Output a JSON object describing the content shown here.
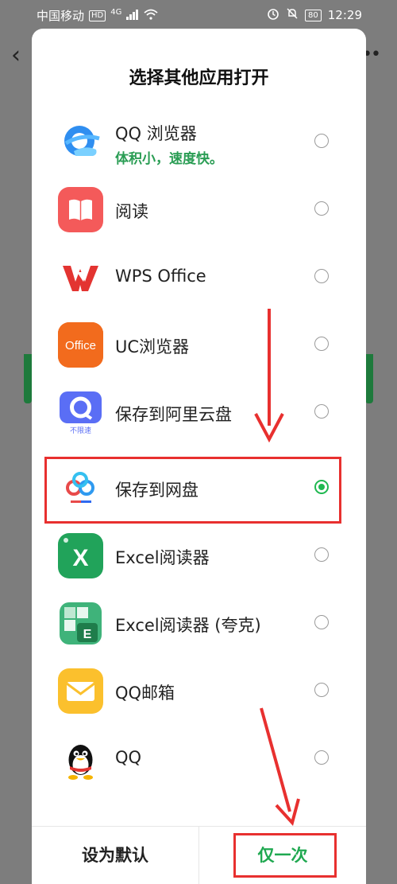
{
  "status_bar": {
    "carrier": "中国移动",
    "hd": "HD",
    "network": "4G",
    "battery": "80",
    "time": "12:29"
  },
  "sheet": {
    "title": "选择其他应用打开",
    "apps": [
      {
        "name": "QQ 浏览器",
        "subtitle": "体积小，速度快。",
        "icon": "qq-browser-icon",
        "selected": false
      },
      {
        "name": "阅读",
        "icon": "reader-book-icon",
        "selected": false
      },
      {
        "name": "WPS Office",
        "icon": "wps-office-icon",
        "selected": false
      },
      {
        "name": "UC浏览器",
        "icon": "uc-browser-office-icon",
        "icon_text": "Office",
        "selected": false
      },
      {
        "name": "保存到阿里云盘",
        "icon": "aliyun-drive-icon",
        "icon_text": "不限速",
        "selected": false
      },
      {
        "name": "保存到网盘",
        "icon": "baidu-netdisk-icon",
        "selected": true
      },
      {
        "name": "Excel阅读器",
        "icon": "excel-reader-icon",
        "icon_text": "X",
        "selected": false
      },
      {
        "name": "Excel阅读器 (夸克)",
        "icon": "excel-quark-icon",
        "icon_text": "E",
        "selected": false
      },
      {
        "name": "QQ邮箱",
        "icon": "qq-mail-icon",
        "selected": false
      },
      {
        "name": "QQ",
        "icon": "qq-penguin-icon",
        "selected": false
      }
    ],
    "footer": {
      "set_default": "设为默认",
      "just_once": "仅一次"
    }
  },
  "colors": {
    "accent_green": "#1fb850",
    "annotation_red": "#e8302f"
  }
}
